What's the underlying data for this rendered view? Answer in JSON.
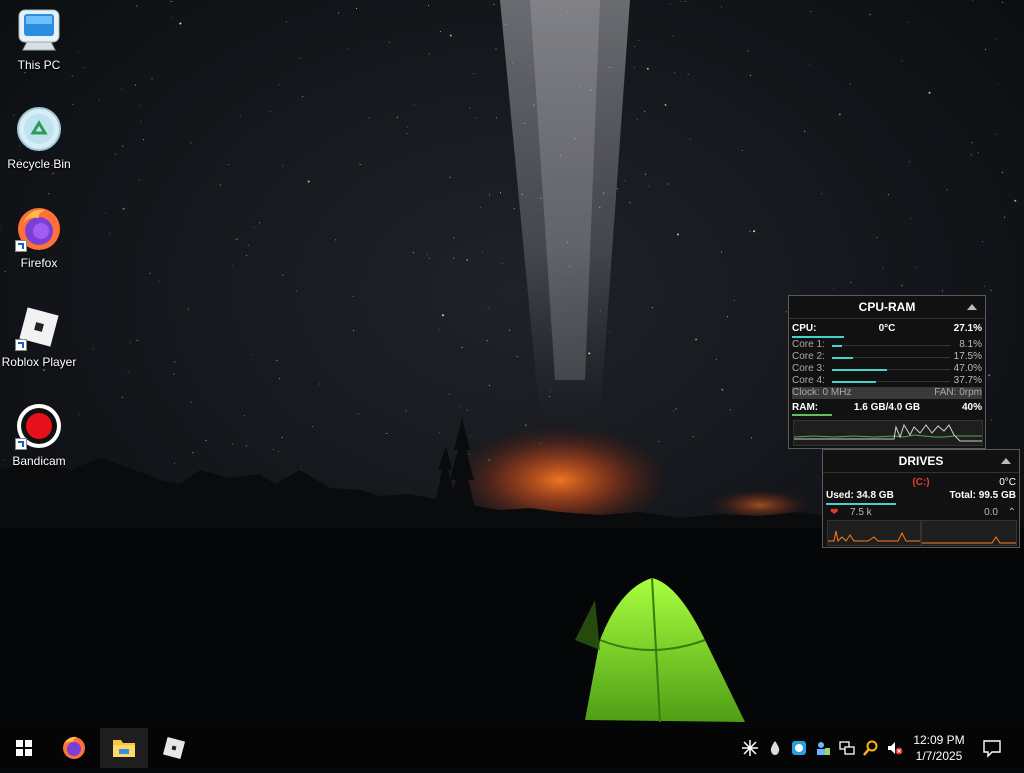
{
  "desktop": {
    "icons": [
      {
        "label": "This PC",
        "icon": "this-pc-icon"
      },
      {
        "label": "Recycle Bin",
        "icon": "recycle-bin-icon"
      },
      {
        "label": "Firefox",
        "icon": "firefox-icon"
      },
      {
        "label": "Roblox Player",
        "icon": "roblox-icon"
      },
      {
        "label": "Bandicam",
        "icon": "bandicam-icon"
      }
    ]
  },
  "cpu_ram": {
    "title": "CPU-RAM",
    "cpu_label": "CPU:",
    "cpu_temp": "0°C",
    "cpu_usage": "27.1%",
    "cores": [
      {
        "label": "Core 1:",
        "value": "8.1%",
        "level": 0.081
      },
      {
        "label": "Core 2:",
        "value": "17.5%",
        "level": 0.175
      },
      {
        "label": "Core 3:",
        "value": "47.0%",
        "level": 0.47
      },
      {
        "label": "Core 4:",
        "value": "37.7%",
        "level": 0.377
      }
    ],
    "clock": "Clock: 0 MHz",
    "fan": "FAN: 0rpm",
    "ram_label": "RAM:",
    "ram_used": "1.6 GB/4.0 GB",
    "ram_pct": "40%"
  },
  "drives": {
    "title": "DRIVES",
    "drive": "(C:)",
    "temp": "0°C",
    "used": "Used: 34.8 GB",
    "total": "Total: 99.5 GB",
    "read": "7.5 k",
    "write": "0.0"
  },
  "taskbar": {
    "clock_time": "12:09 PM",
    "clock_date": "1/7/2025",
    "pinned": [
      "start-button",
      "firefox",
      "file-explorer",
      "roblox"
    ]
  },
  "colors": {
    "accent_cyan": "#47d1c9",
    "drive_red": "#e0402a",
    "graph_orange": "#ff7a1a",
    "tent_green": "#7fe02a"
  }
}
